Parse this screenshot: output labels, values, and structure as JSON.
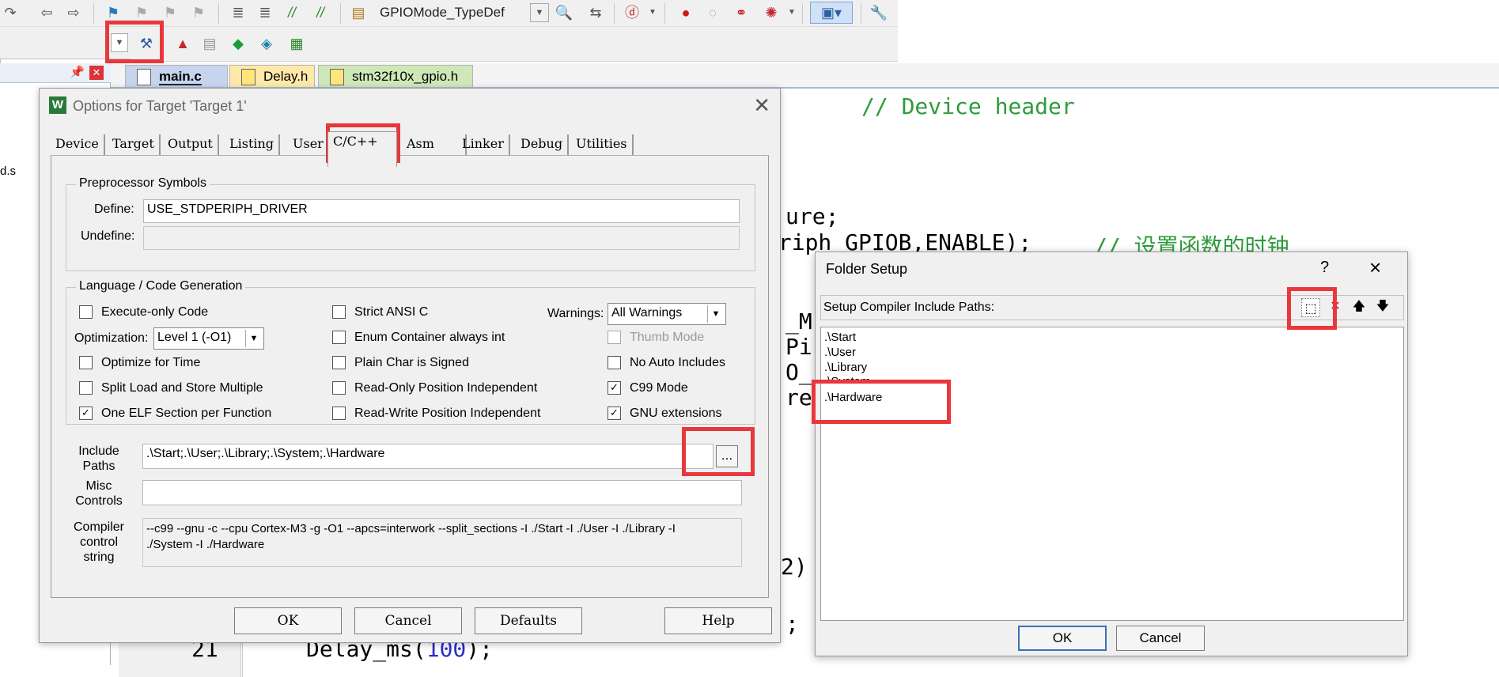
{
  "toolbar": {
    "target_name": "GPIOMode_TypeDef",
    "target_combo_value": "1",
    "icons": [
      "redo-icon",
      "back-icon",
      "forward-icon",
      "bookmark-icon",
      "bookmark-prev-icon",
      "bookmark-next-icon",
      "bookmark-clear-icon",
      "indent-icon",
      "unindent-icon",
      "comment-icon",
      "uncomment-icon",
      "find-in-files-icon",
      "find-icon",
      "debug-icon",
      "breakpoint-icon",
      "breakpoint-disable-icon",
      "breakpoint-clear-icon",
      "breakpoint-kill-icon",
      "view-icon",
      "configure-icon",
      "options-for-target-icon",
      "manage-project-icon",
      "batch-build-icon",
      "pack-installer-icon",
      "select-packs-icon",
      "rte-icon"
    ]
  },
  "editor": {
    "tabs": [
      {
        "label": "main.c",
        "color": "#c7d4ee",
        "active": true
      },
      {
        "label": "Delay.h",
        "color": "#ffe9a8",
        "active": false
      },
      {
        "label": "stm32f10x_gpio.h",
        "color": "#cfe8b8",
        "active": false
      }
    ],
    "project_side_text": "d.s",
    "visible_code": {
      "header_comment": "// Device header",
      "line_ure": "ure;",
      "line_periph": "eriph_GPIOB,ENABLE);",
      "line_periph_comment": "// 设置函数的时钟",
      "frag_m": "_M",
      "frag_pi": "Pi",
      "frag_o": "O_",
      "frag_re": "re",
      "frag_2": "2)",
      "frag_semicolon": ";",
      "line_number": "21",
      "delay_call": "Delay_ms(",
      "delay_arg": "100",
      "delay_end": ");"
    }
  },
  "options_dialog": {
    "title": "Options for Target 'Target 1'",
    "tabs": [
      "Device",
      "Target",
      "Output",
      "Listing",
      "User",
      "C/C++",
      "Asm",
      "Linker",
      "Debug",
      "Utilities"
    ],
    "active_tab": "C/C++",
    "preprocessor": {
      "group_label": "Preprocessor Symbols",
      "define_label": "Define:",
      "define_value": "USE_STDPERIPH_DRIVER",
      "undefine_label": "Undefine:",
      "undefine_value": ""
    },
    "language": {
      "group_label": "Language / Code Generation",
      "execute_only": {
        "label": "Execute-only Code",
        "checked": false
      },
      "optimization_label": "Optimization:",
      "optimization_value": "Level 1 (-O1)",
      "optimize_time": {
        "label": "Optimize for Time",
        "checked": false
      },
      "split_load": {
        "label": "Split Load and Store Multiple",
        "checked": false
      },
      "one_elf": {
        "label": "One ELF Section per Function",
        "checked": true
      },
      "strict_ansi": {
        "label": "Strict ANSI C",
        "checked": false
      },
      "enum_container": {
        "label": "Enum Container always int",
        "checked": false
      },
      "plain_char": {
        "label": "Plain Char is Signed",
        "checked": false
      },
      "ro_pi": {
        "label": "Read-Only Position Independent",
        "checked": false
      },
      "rw_pi": {
        "label": "Read-Write Position Independent",
        "checked": false
      },
      "warnings_label": "Warnings:",
      "warnings_value": "All Warnings",
      "thumb_mode": {
        "label": "Thumb Mode",
        "checked": false,
        "disabled": true
      },
      "no_auto_includes": {
        "label": "No Auto Includes",
        "checked": false
      },
      "c99_mode": {
        "label": "C99 Mode",
        "checked": true
      },
      "gnu_extensions": {
        "label": "GNU extensions",
        "checked": true
      }
    },
    "include_paths_label_1": "Include",
    "include_paths_label_2": "Paths",
    "include_paths_value": ".\\Start;.\\User;.\\Library;.\\System;.\\Hardware",
    "browse_label": "...",
    "misc_label_1": "Misc",
    "misc_label_2": "Controls",
    "misc_value": "",
    "compiler_label_1": "Compiler",
    "compiler_label_2": "control",
    "compiler_label_3": "string",
    "compiler_line_1": "--c99 --gnu -c --cpu Cortex-M3 -g -O1 --apcs=interwork --split_sections -I ./Start -I ./User -I ./Library -I",
    "compiler_line_2": "./System -I ./Hardware",
    "buttons": {
      "ok": "OK",
      "cancel": "Cancel",
      "defaults": "Defaults",
      "help": "Help"
    }
  },
  "folder_setup": {
    "title": "Folder Setup",
    "help_glyph": "?",
    "close_glyph": "×",
    "list_label": "Setup Compiler Include Paths:",
    "paths": [
      ".\\Start",
      ".\\User",
      ".\\Library",
      ".\\System",
      ".\\Hardware"
    ],
    "buttons": {
      "ok": "OK",
      "cancel": "Cancel"
    }
  },
  "highlight_color": "#e8383d"
}
